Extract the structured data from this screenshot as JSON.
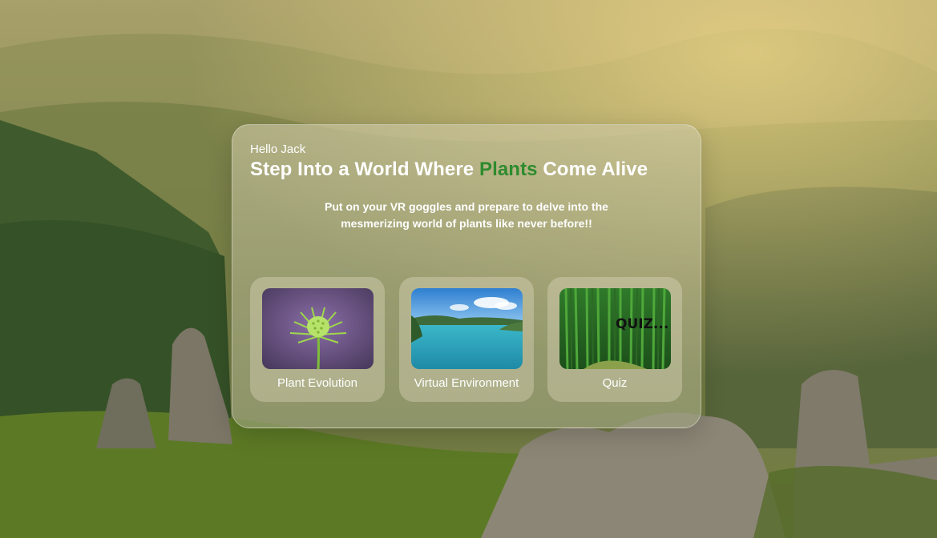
{
  "greeting": "Hello Jack",
  "headline": {
    "part1": "Step Into a World Where ",
    "accent": "Plants",
    "part2": " Come Alive"
  },
  "subtitle": {
    "line1": "Put on your VR goggles and prepare to delve into the",
    "line2": "mesmerizing world of plants  like never before!!"
  },
  "cards": [
    {
      "label": "Plant Evolution",
      "icon": "plant-flower-image"
    },
    {
      "label": "Virtual Environment",
      "icon": "lake-landscape-image"
    },
    {
      "label": "Quiz",
      "icon": "bamboo-forest-image",
      "overlay_text": "QUIZ..."
    }
  ],
  "colors": {
    "accent": "#2e8b2e",
    "text": "#ffffff"
  }
}
